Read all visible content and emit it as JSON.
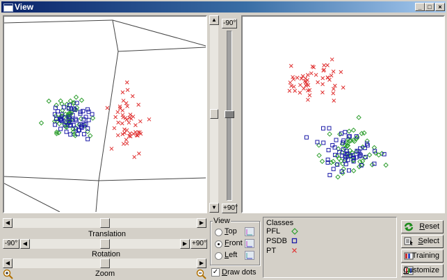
{
  "window": {
    "title": "View",
    "buttons": [
      "_",
      "□",
      "×"
    ]
  },
  "slider_vertical": {
    "top_label": "-90°",
    "bottom_label": "+90°",
    "position_fraction": 0.5
  },
  "translation": {
    "label": "Translation",
    "position_fraction": 0.5
  },
  "rotation": {
    "label": "Rotation",
    "min_label": "-90°",
    "max_label": "+90°",
    "position_fraction": 0.5
  },
  "zoom": {
    "label": "Zoom",
    "position_fraction": 0.5
  },
  "view_group": {
    "title": "View",
    "options": [
      {
        "label_prefix": "",
        "accel": "T",
        "label_rest": "op",
        "selected": false
      },
      {
        "label_prefix": "",
        "accel": "F",
        "label_rest": "ront",
        "selected": true
      },
      {
        "label_prefix": "",
        "accel": "L",
        "label_rest": "eft",
        "selected": false
      }
    ],
    "draw_dots": {
      "accel": "D",
      "label_rest": "raw dots",
      "checked": true
    }
  },
  "classes": {
    "title": "Classes",
    "items": [
      {
        "name": "PFL",
        "marker": "diamond",
        "color": "#2e9e2e"
      },
      {
        "name": "PSDB",
        "marker": "square",
        "color": "#1c1ca8"
      },
      {
        "name": "PT",
        "marker": "cross",
        "color": "#e03030"
      }
    ]
  },
  "buttons": [
    {
      "accel": "R",
      "rest": "eset",
      "icon": "refresh-icon"
    },
    {
      "accel": "S",
      "rest": "elect",
      "icon": "select-icon"
    },
    {
      "accel": "",
      "rest": "Training",
      "icon": "training-icon"
    },
    {
      "accel": "C",
      "rest": "ustomize",
      "icon": "customize-icon"
    }
  ]
}
